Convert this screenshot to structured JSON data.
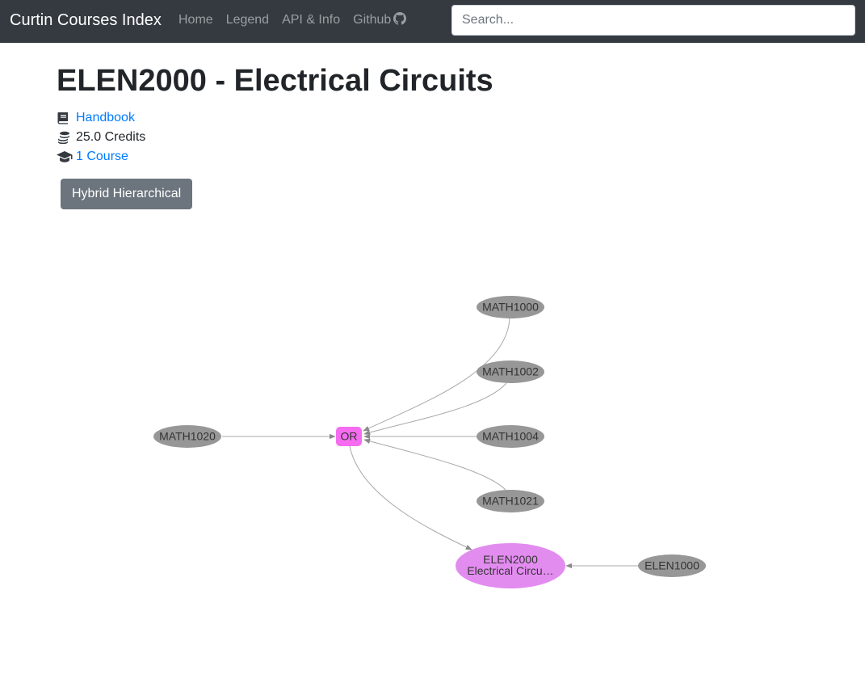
{
  "navbar": {
    "brand": "Curtin Courses Index",
    "links": [
      "Home",
      "Legend",
      "API & Info",
      "Github"
    ],
    "search_placeholder": "Search..."
  },
  "page": {
    "title": "ELEN2000 - Electrical Circuits",
    "handbook_label": "Handbook",
    "credits_label": "25.0 Credits",
    "courses_label": "1 Course",
    "layout_button": "Hybrid Hierarchical"
  },
  "graph": {
    "nodes": {
      "math1000": "MATH1000",
      "math1002": "MATH1002",
      "math1004": "MATH1004",
      "math1021": "MATH1021",
      "math1020": "MATH1020",
      "or": "OR",
      "elen2000_code": "ELEN2000",
      "elen2000_name": "Electrical Circu…",
      "elen1000": "ELEN1000"
    },
    "colors": {
      "prereq_node": "#979797",
      "or_node": "#f56cf0",
      "target_node": "#e38cf0",
      "edge": "#a9a9a9"
    }
  }
}
